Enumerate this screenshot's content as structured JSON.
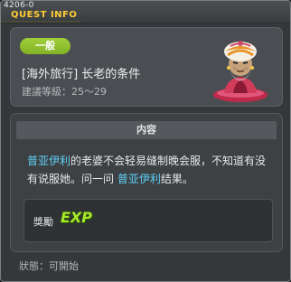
{
  "window": {
    "quest_id": "4206-0",
    "title": "QUEST INFO"
  },
  "quest": {
    "category": "一般",
    "name": "[海外旅行] 长老的条件",
    "level_label": "建議等級：25～29"
  },
  "content": {
    "header": "内容",
    "desc_npc1": "普亚伊利",
    "desc_text1": "的老婆不会轻易缝制晚会服，不知道有没有说服她。问一问",
    "desc_npc2": "普亚伊利",
    "desc_text2": "结果。"
  },
  "reward": {
    "label": "獎勵",
    "exp_text": "EXP"
  },
  "status": {
    "label": "狀態：可開始"
  },
  "colors": {
    "title": "#ffcc33",
    "category_bg": "#95c631",
    "npc_link": "#5fd0f5",
    "exp": "#a6ea2c"
  }
}
